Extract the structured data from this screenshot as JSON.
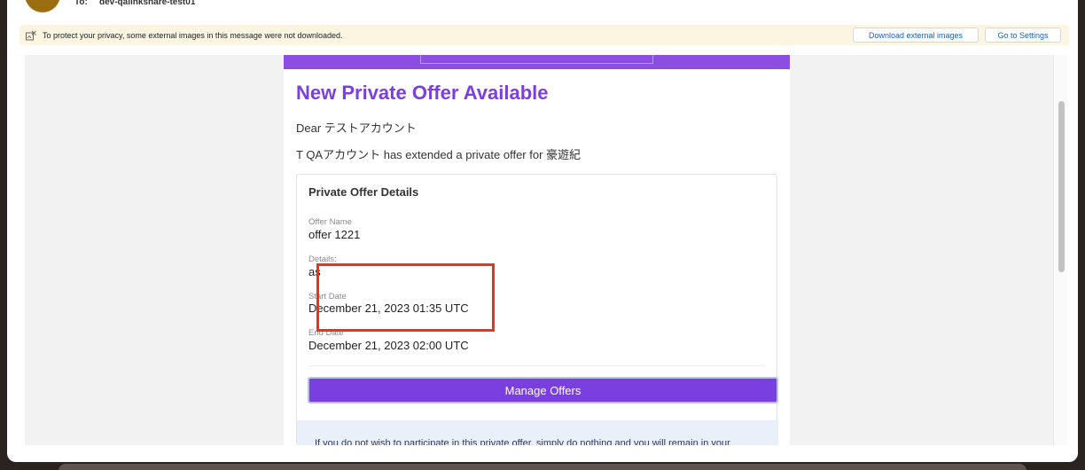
{
  "header": {
    "to_label": "To:",
    "to_value": "dev-qalinkshare-test01"
  },
  "privacy_bar": {
    "icon": "image-blocked-icon",
    "message": "To protect your privacy, some external images in this message were not downloaded.",
    "download_label": "Download external images",
    "settings_label": "Go to Settings"
  },
  "email": {
    "title": "New Private Offer Available",
    "greeting": "Dear テストアカウント",
    "intro": "T QAアカウント has extended a private offer for 豪遊紀",
    "details_title": "Private Offer Details",
    "fields": [
      {
        "label": "Offer Name",
        "value": "offer 1221"
      },
      {
        "label": "Details:",
        "value": "as"
      },
      {
        "label": "Start Date",
        "value": "December 21, 2023 01:35 UTC"
      },
      {
        "label": "End Date",
        "value": "December 21, 2023 02:00 UTC"
      }
    ],
    "manage_button": "Manage Offers",
    "notice": "If you do not wish to participate in this private offer, simply do nothing and you will remain in your"
  },
  "colors": {
    "accent_purple": "#7b3fe0",
    "highlight_red": "#e8341c",
    "privacy_bg": "#fbf5e1"
  }
}
